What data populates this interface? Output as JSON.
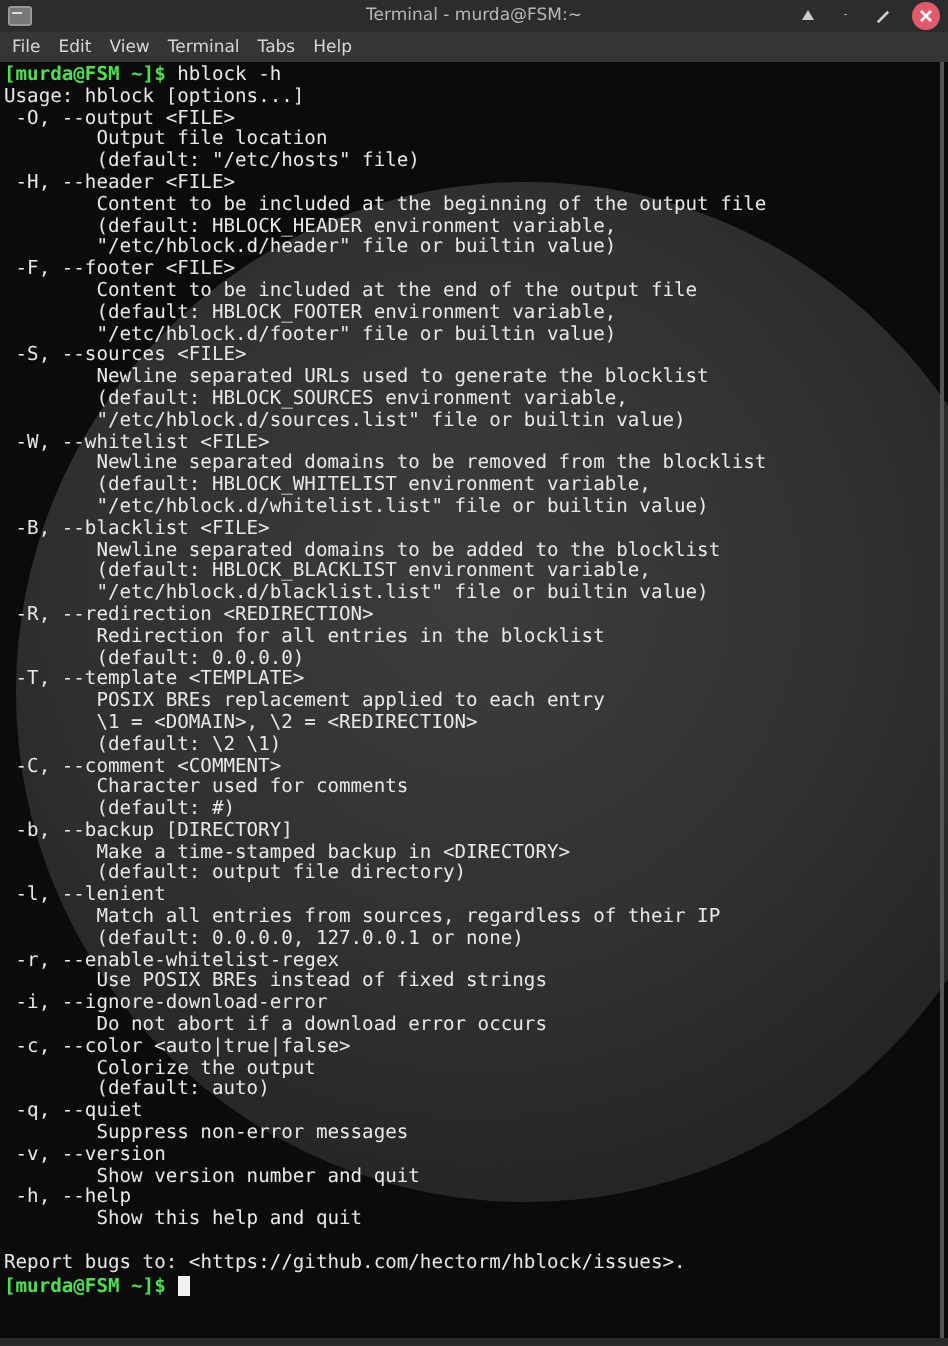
{
  "window": {
    "title": "Terminal - murda@FSM:~"
  },
  "menu": [
    "File",
    "Edit",
    "View",
    "Terminal",
    "Tabs",
    "Help"
  ],
  "terminal": {
    "lines": [
      {
        "kind": "prompt",
        "prompt": "[murda@FSM ~]$",
        "command": "hblock -h"
      },
      {
        "kind": "plain",
        "text": "Usage: hblock [options...]"
      },
      {
        "kind": "option",
        "text": "-O, --output <FILE>"
      },
      {
        "kind": "desc",
        "text": "Output file location"
      },
      {
        "kind": "desc",
        "text": "(default: \"/etc/hosts\" file)"
      },
      {
        "kind": "option",
        "text": "-H, --header <FILE>"
      },
      {
        "kind": "desc",
        "text": "Content to be included at the beginning of the output file"
      },
      {
        "kind": "desc",
        "text": "(default: HBLOCK_HEADER environment variable,"
      },
      {
        "kind": "desc",
        "text": "\"/etc/hblock.d/header\" file or builtin value)"
      },
      {
        "kind": "option",
        "text": "-F, --footer <FILE>"
      },
      {
        "kind": "desc",
        "text": "Content to be included at the end of the output file"
      },
      {
        "kind": "desc",
        "text": "(default: HBLOCK_FOOTER environment variable,"
      },
      {
        "kind": "desc",
        "text": "\"/etc/hblock.d/footer\" file or builtin value)"
      },
      {
        "kind": "option",
        "text": "-S, --sources <FILE>"
      },
      {
        "kind": "desc",
        "text": "Newline separated URLs used to generate the blocklist"
      },
      {
        "kind": "desc",
        "text": "(default: HBLOCK_SOURCES environment variable,"
      },
      {
        "kind": "desc",
        "text": "\"/etc/hblock.d/sources.list\" file or builtin value)"
      },
      {
        "kind": "option",
        "text": "-W, --whitelist <FILE>"
      },
      {
        "kind": "desc",
        "text": "Newline separated domains to be removed from the blocklist"
      },
      {
        "kind": "desc",
        "text": "(default: HBLOCK_WHITELIST environment variable,"
      },
      {
        "kind": "desc",
        "text": "\"/etc/hblock.d/whitelist.list\" file or builtin value)"
      },
      {
        "kind": "option",
        "text": "-B, --blacklist <FILE>"
      },
      {
        "kind": "desc",
        "text": "Newline separated domains to be added to the blocklist"
      },
      {
        "kind": "desc",
        "text": "(default: HBLOCK_BLACKLIST environment variable,"
      },
      {
        "kind": "desc",
        "text": "\"/etc/hblock.d/blacklist.list\" file or builtin value)"
      },
      {
        "kind": "option",
        "text": "-R, --redirection <REDIRECTION>"
      },
      {
        "kind": "desc",
        "text": "Redirection for all entries in the blocklist"
      },
      {
        "kind": "desc",
        "text": "(default: 0.0.0.0)"
      },
      {
        "kind": "option",
        "text": "-T, --template <TEMPLATE>"
      },
      {
        "kind": "desc",
        "text": "POSIX BREs replacement applied to each entry"
      },
      {
        "kind": "desc",
        "text": "\\1 = <DOMAIN>, \\2 = <REDIRECTION>"
      },
      {
        "kind": "desc",
        "text": "(default: \\2 \\1)"
      },
      {
        "kind": "option",
        "text": "-C, --comment <COMMENT>"
      },
      {
        "kind": "desc",
        "text": "Character used for comments"
      },
      {
        "kind": "desc",
        "text": "(default: #)"
      },
      {
        "kind": "option",
        "text": "-b, --backup [DIRECTORY]"
      },
      {
        "kind": "desc",
        "text": "Make a time-stamped backup in <DIRECTORY>"
      },
      {
        "kind": "desc",
        "text": "(default: output file directory)"
      },
      {
        "kind": "option",
        "text": "-l, --lenient"
      },
      {
        "kind": "desc",
        "text": "Match all entries from sources, regardless of their IP"
      },
      {
        "kind": "desc",
        "text": "(default: 0.0.0.0, 127.0.0.1 or none)"
      },
      {
        "kind": "option",
        "text": "-r, --enable-whitelist-regex"
      },
      {
        "kind": "desc",
        "text": "Use POSIX BREs instead of fixed strings"
      },
      {
        "kind": "option",
        "text": "-i, --ignore-download-error"
      },
      {
        "kind": "desc",
        "text": "Do not abort if a download error occurs"
      },
      {
        "kind": "option",
        "text": "-c, --color <auto|true|false>"
      },
      {
        "kind": "desc",
        "text": "Colorize the output"
      },
      {
        "kind": "desc",
        "text": "(default: auto)"
      },
      {
        "kind": "option",
        "text": "-q, --quiet"
      },
      {
        "kind": "desc",
        "text": "Suppress non-error messages"
      },
      {
        "kind": "option",
        "text": "-v, --version"
      },
      {
        "kind": "desc",
        "text": "Show version number and quit"
      },
      {
        "kind": "option",
        "text": "-h, --help"
      },
      {
        "kind": "desc",
        "text": "Show this help and quit"
      },
      {
        "kind": "blank"
      },
      {
        "kind": "plain",
        "text": "Report bugs to: <https://github.com/hectorm/hblock/issues>."
      },
      {
        "kind": "prompt",
        "prompt": "[murda@FSM ~]$",
        "cursor": true
      }
    ]
  }
}
